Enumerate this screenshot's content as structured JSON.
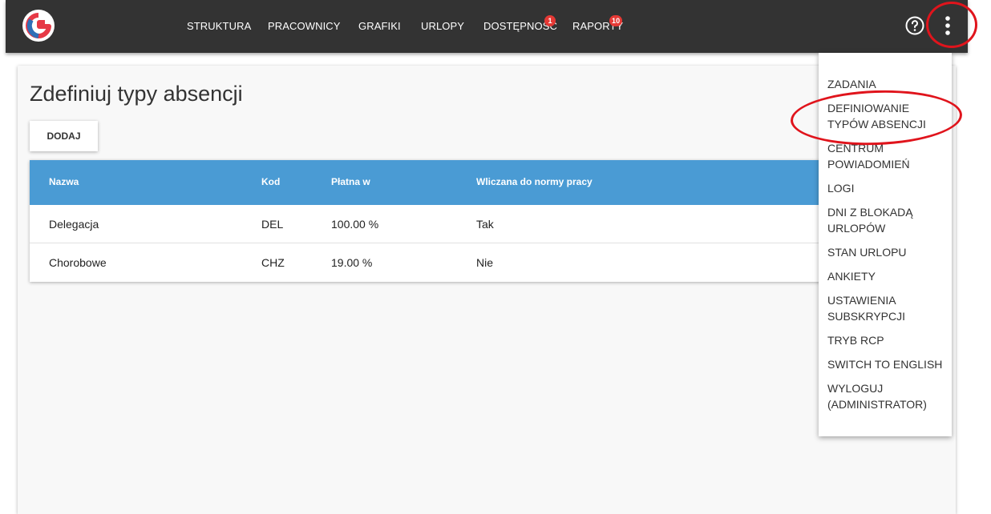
{
  "navbar": {
    "items": [
      {
        "label": "STRUKTURA"
      },
      {
        "label": "PRACOWNICY"
      },
      {
        "label": "GRAFIKI"
      },
      {
        "label": "URLOPY"
      },
      {
        "label": "DOSTĘPNOŚĆ",
        "badge": "1"
      },
      {
        "label": "RAPORTY",
        "badge": "10"
      }
    ],
    "icons": [
      "logo",
      "help-icon",
      "more-vert-icon"
    ]
  },
  "page": {
    "title": "Zdefiniuj typy absencji",
    "add_label": "DODAJ"
  },
  "table": {
    "headers": [
      "Nazwa",
      "Kod",
      "Płatna w",
      "Wliczana do normy pracy"
    ],
    "rows": [
      [
        "Delegacja",
        "DEL",
        "100.00 %",
        "Tak"
      ],
      [
        "Chorobowe",
        "CHZ",
        "19.00 %",
        "Nie"
      ]
    ]
  },
  "menu": {
    "items": [
      "ZADANIA",
      "DEFINIOWANIE TYPÓW ABSENCJI",
      "CENTRUM POWIADOMIEŃ",
      "LOGI",
      "DNI Z BLOKADĄ URLOPÓW",
      "STAN URLOPU",
      "ANKIETY",
      "USTAWIENIA SUBSKRYPCJI",
      "TRYB RCP",
      "SWITCH TO ENGLISH",
      "WYLOGUJ (ADMINISTRATOR)"
    ]
  },
  "colors": {
    "navbar": "#333333",
    "table_header": "#4a9bd4",
    "badge": "#e53935",
    "annotation": "#e0141c"
  }
}
